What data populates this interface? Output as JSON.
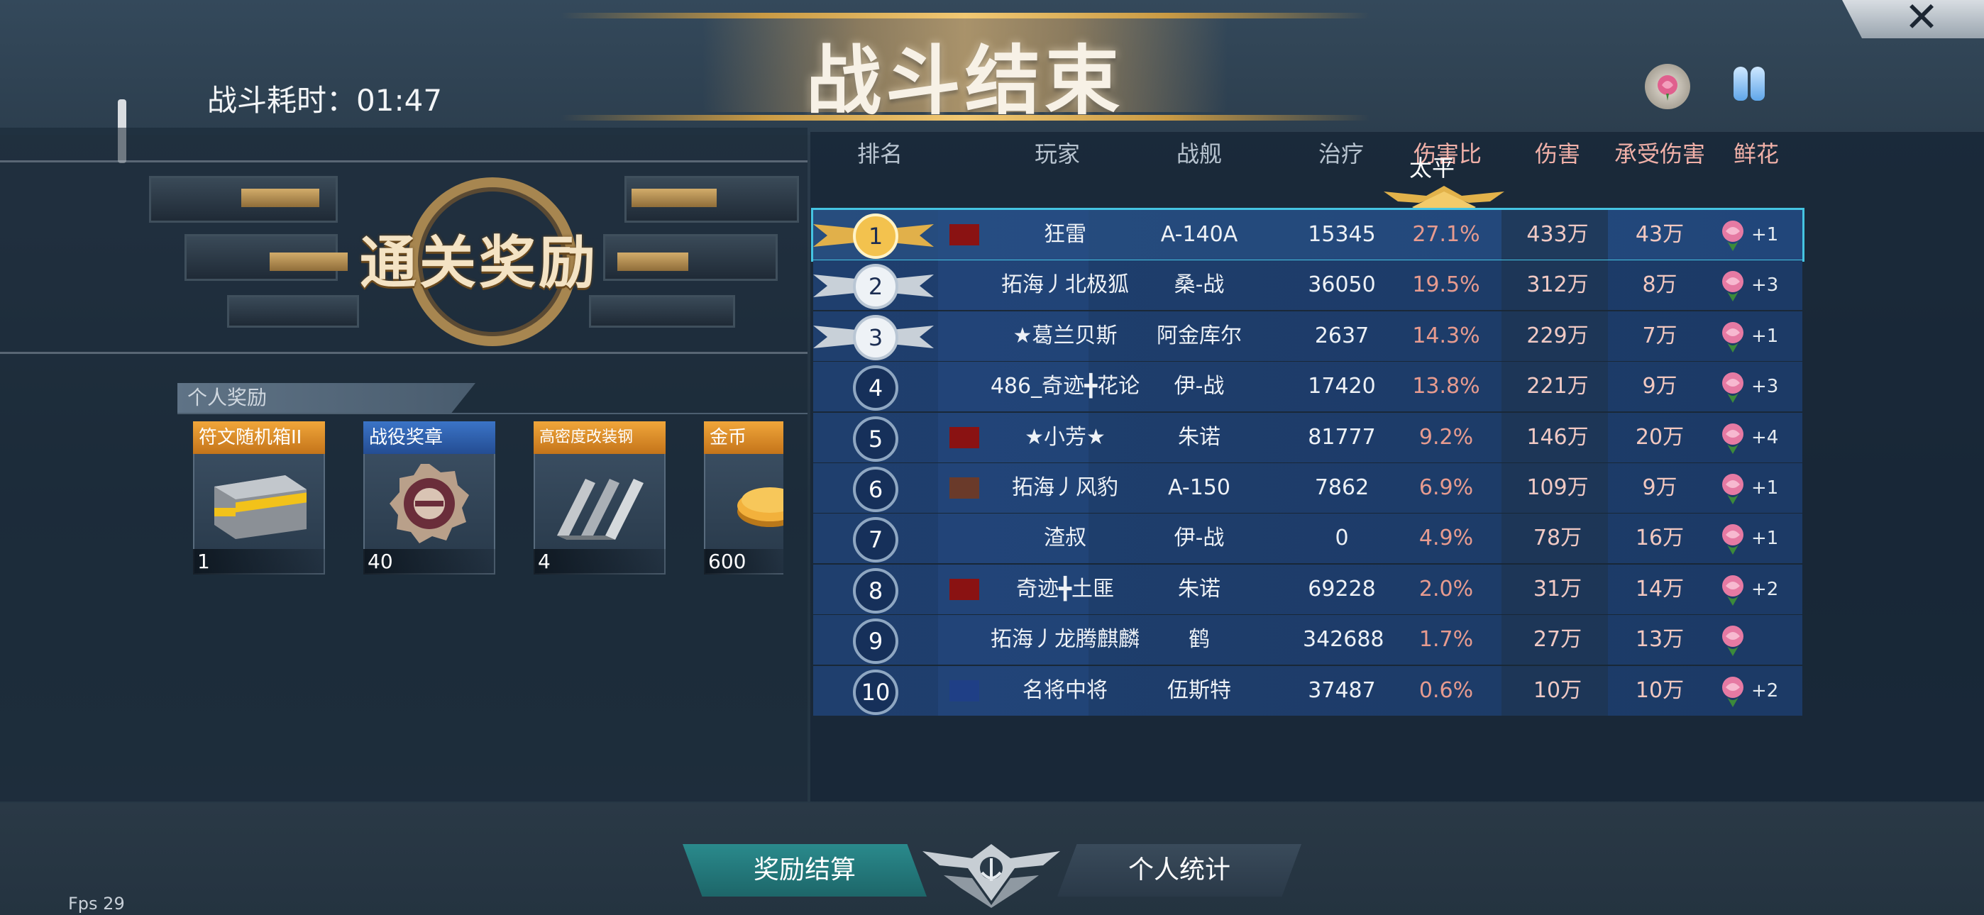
{
  "header": {
    "timer_text": "战斗耗时：01:47",
    "title": "战斗结束",
    "close_symbol": "✕",
    "icons": [
      "rose-icon",
      "flipflops-icon"
    ]
  },
  "rewards": {
    "banner_title": "通关奖励",
    "section_label": "个人奖励",
    "items": [
      {
        "name": "符文随机箱II",
        "count": "1",
        "tag_color": "#f0a63a",
        "icon": "crate-icon"
      },
      {
        "name": "战役奖章",
        "count": "40",
        "tag_color": "#3b74c7",
        "icon": "medal-icon"
      },
      {
        "name": "高密度改装钢",
        "count": "4",
        "tag_color": "#f0a63a",
        "icon": "steel-icon"
      },
      {
        "name": "金币",
        "count": "600",
        "tag_color": "#f0a63a",
        "icon": "coin-icon"
      }
    ]
  },
  "table": {
    "headers": {
      "rank": "排名",
      "player": "玩家",
      "ship": "战舰",
      "heal": "治疗",
      "ratio": "伤害比",
      "damage": "伤害",
      "taken": "承受伤害",
      "flowers": "鲜花"
    },
    "top_label": "太平",
    "rows": [
      {
        "rank": "1",
        "player": "狂雷",
        "ship": "A-140A",
        "heal": "15345",
        "ratio": "27.1%",
        "damage": "433万",
        "taken": "43万",
        "flowers": "+1",
        "flag": "red-flag"
      },
      {
        "rank": "2",
        "player": "拓海丿北极狐",
        "ship": "桑-战",
        "heal": "36050",
        "ratio": "19.5%",
        "damage": "312万",
        "taken": "8万",
        "flowers": "+3",
        "flag": ""
      },
      {
        "rank": "3",
        "player": "★葛兰贝斯",
        "ship": "阿金库尔",
        "heal": "2637",
        "ratio": "14.3%",
        "damage": "229万",
        "taken": "7万",
        "flowers": "+1",
        "flag": ""
      },
      {
        "rank": "4",
        "player": "486_奇迹╋花论",
        "ship": "伊-战",
        "heal": "17420",
        "ratio": "13.8%",
        "damage": "221万",
        "taken": "9万",
        "flowers": "+3",
        "flag": ""
      },
      {
        "rank": "5",
        "player": "★小芳★",
        "ship": "朱诺",
        "heal": "81777",
        "ratio": "9.2%",
        "damage": "146万",
        "taken": "20万",
        "flowers": "+4",
        "flag": "red-flag"
      },
      {
        "rank": "6",
        "player": "拓海丿风豹",
        "ship": "A-150",
        "heal": "7862",
        "ratio": "6.9%",
        "damage": "109万",
        "taken": "9万",
        "flowers": "+1",
        "flag": "brown-flag"
      },
      {
        "rank": "7",
        "player": "渣叔",
        "ship": "伊-战",
        "heal": "0",
        "ratio": "4.9%",
        "damage": "78万",
        "taken": "16万",
        "flowers": "+1",
        "flag": ""
      },
      {
        "rank": "8",
        "player": "奇迹╋土匪",
        "ship": "朱诺",
        "heal": "69228",
        "ratio": "2.0%",
        "damage": "31万",
        "taken": "14万",
        "flowers": "+2",
        "flag": "red-flag"
      },
      {
        "rank": "9",
        "player": "拓海丿龙腾麒麟",
        "ship": "鹤",
        "heal": "342688",
        "ratio": "1.7%",
        "damage": "27万",
        "taken": "13万",
        "flowers": "",
        "flag": ""
      },
      {
        "rank": "10",
        "player": "名将中将",
        "ship": "伍斯特",
        "heal": "37487",
        "ratio": "0.6%",
        "damage": "10万",
        "taken": "10万",
        "flowers": "+2",
        "flag": "blue-flag"
      }
    ]
  },
  "footer": {
    "left_tab": "奖励结算",
    "right_tab": "个人统计",
    "fps": "Fps 29"
  }
}
